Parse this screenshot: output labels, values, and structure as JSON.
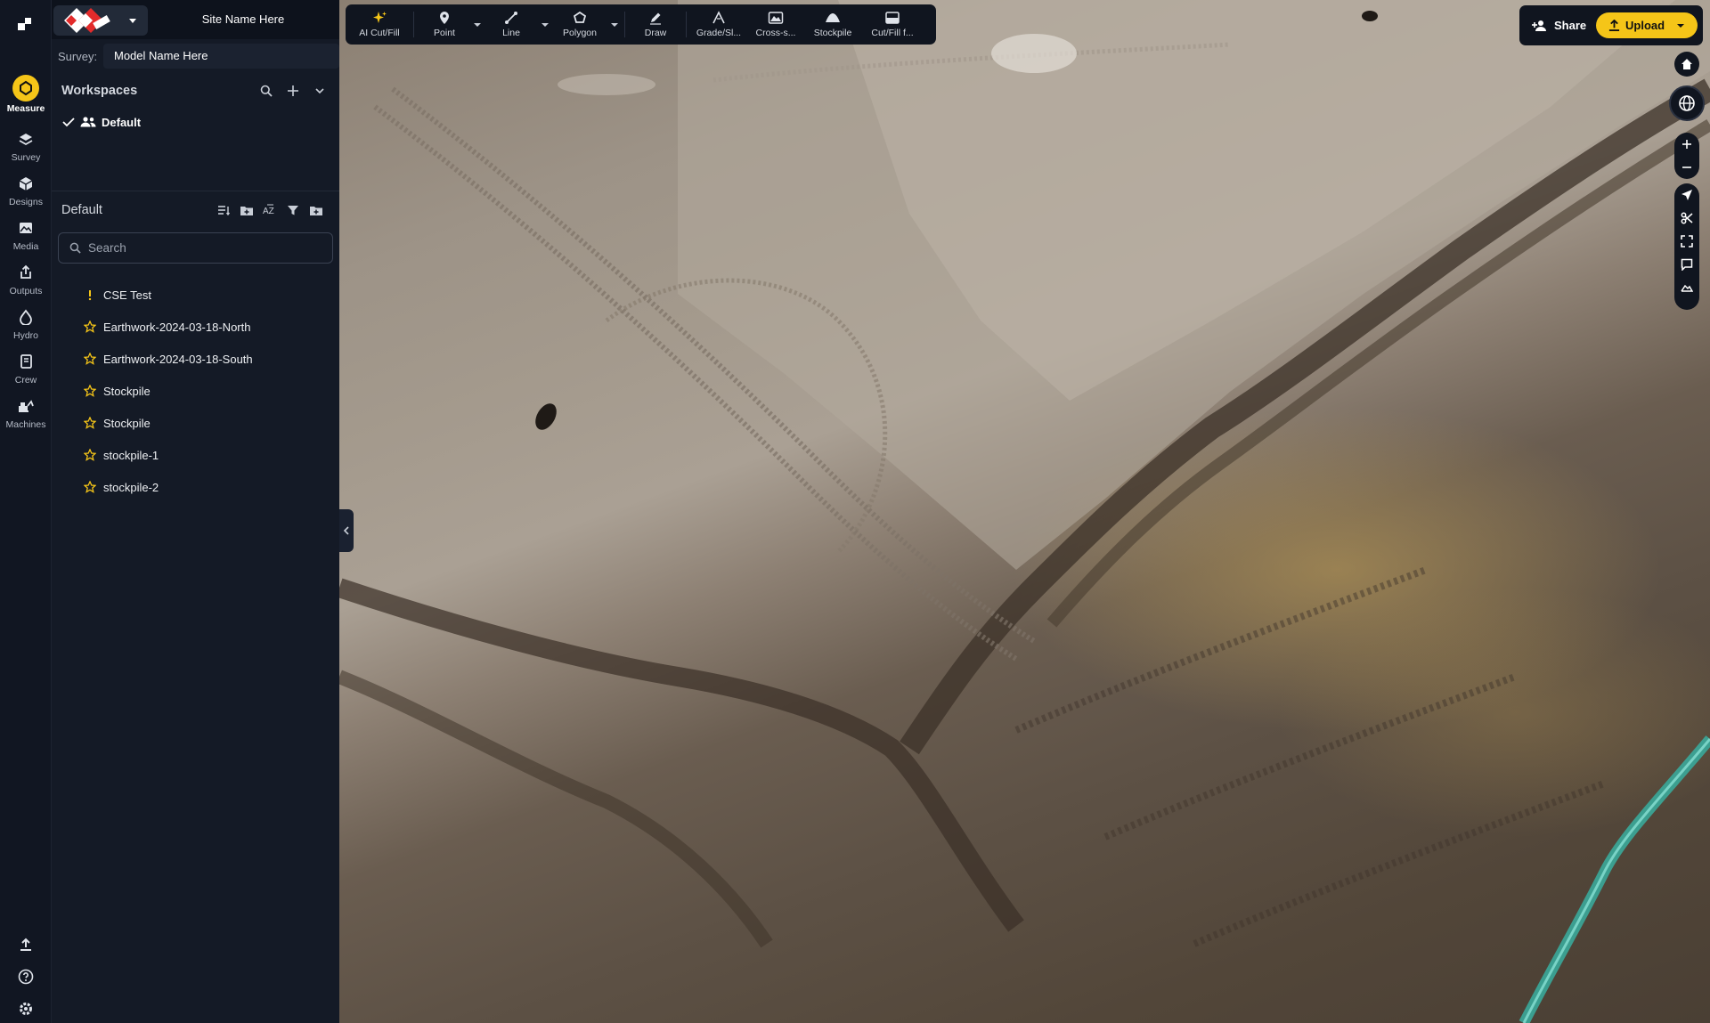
{
  "header": {
    "site_name": "Site Name Here",
    "survey_label": "Survey:",
    "survey_value": "Model Name Here"
  },
  "rail": {
    "items": [
      {
        "label": "Measure",
        "icon": "measure-icon",
        "active": true
      },
      {
        "label": "Survey",
        "icon": "layers-icon"
      },
      {
        "label": "Designs",
        "icon": "cube-icon"
      },
      {
        "label": "Media",
        "icon": "image-icon"
      },
      {
        "label": "Outputs",
        "icon": "export-icon"
      },
      {
        "label": "Hydro",
        "icon": "drop-icon"
      },
      {
        "label": "Crew",
        "icon": "clipboard-icon"
      },
      {
        "label": "Machines",
        "icon": "excavator-icon"
      }
    ],
    "bottom": [
      "upload-icon",
      "help-icon",
      "settings-icon"
    ]
  },
  "workspaces": {
    "title": "Workspaces",
    "default_label": "Default"
  },
  "layers": {
    "title": "Default",
    "search_placeholder": "Search",
    "items": [
      {
        "label": "CSE Test",
        "icon": "cse-icon"
      },
      {
        "label": "Earthwork-2024-03-18-North",
        "icon": "star-icon"
      },
      {
        "label": "Earthwork-2024-03-18-South",
        "icon": "star-icon"
      },
      {
        "label": "Stockpile",
        "icon": "star-icon"
      },
      {
        "label": "Stockpile",
        "icon": "star-icon"
      },
      {
        "label": "stockpile-1",
        "icon": "star-icon"
      },
      {
        "label": "stockpile-2",
        "icon": "star-icon"
      }
    ]
  },
  "toolbar": {
    "items": [
      {
        "label": "AI Cut/Fill",
        "icon": "sparkle-icon"
      },
      {
        "label": "Point",
        "icon": "pin-icon"
      },
      {
        "label": "Line",
        "icon": "line-icon"
      },
      {
        "label": "Polygon",
        "icon": "polygon-icon"
      },
      {
        "label": "Draw",
        "icon": "pen-icon"
      },
      {
        "label": "Grade/Sl...",
        "icon": "grade-icon"
      },
      {
        "label": "Cross-s...",
        "icon": "cross-section-icon"
      },
      {
        "label": "Stockpile",
        "icon": "stockpile-icon"
      },
      {
        "label": "Cut/Fill f...",
        "icon": "cutfill-icon"
      }
    ]
  },
  "topright": {
    "share_label": "Share",
    "upload_label": "Upload"
  },
  "colors": {
    "accent": "#f5c518",
    "panel": "#141a26",
    "rail": "#111622",
    "toolbar": "#10151f"
  }
}
